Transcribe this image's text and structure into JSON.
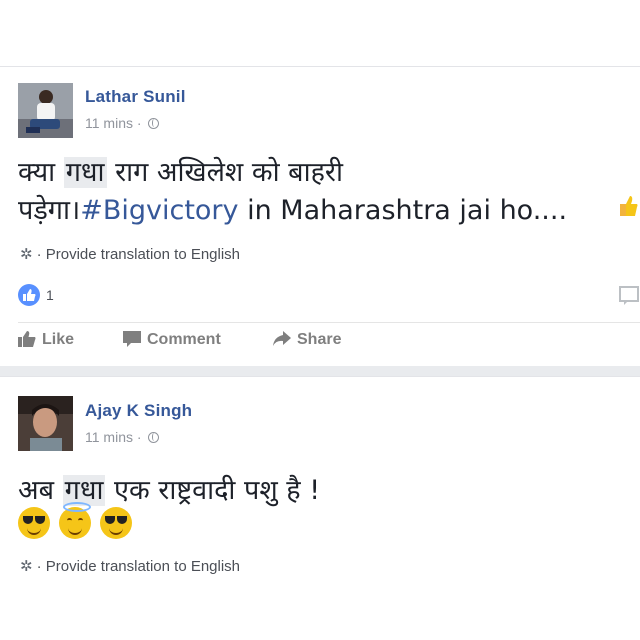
{
  "posts": [
    {
      "author": "Lathar Sunil",
      "time": "11 mins",
      "text_before": "क्या ",
      "text_highlight": "गधा",
      "text_line1_after": " राग अखिलेश को बाहरी",
      "text_line2_start": "पड़ेगा।",
      "hashtag": "#Bigvictory",
      "text_line2_after": " in Maharashtra jai ho....",
      "translate_label": "Provide translation to English",
      "reaction_count": "1",
      "actions": {
        "like": "Like",
        "comment": "Comment",
        "share": "Share"
      }
    },
    {
      "author": "Ajay K Singh",
      "time": "11 mins",
      "text_before": "अब ",
      "text_highlight": "गधा",
      "text_after": " एक राष्ट्रवादी पशु है !",
      "translate_label": "Provide translation to English"
    }
  ],
  "icons": [
    "globe-icon",
    "gear-icon",
    "like-reaction-icon",
    "thumbs-up-icon",
    "comment-icon",
    "share-icon"
  ],
  "colors": {
    "link": "#365899",
    "like_blue": "#5890ff",
    "muted": "#90949c"
  }
}
